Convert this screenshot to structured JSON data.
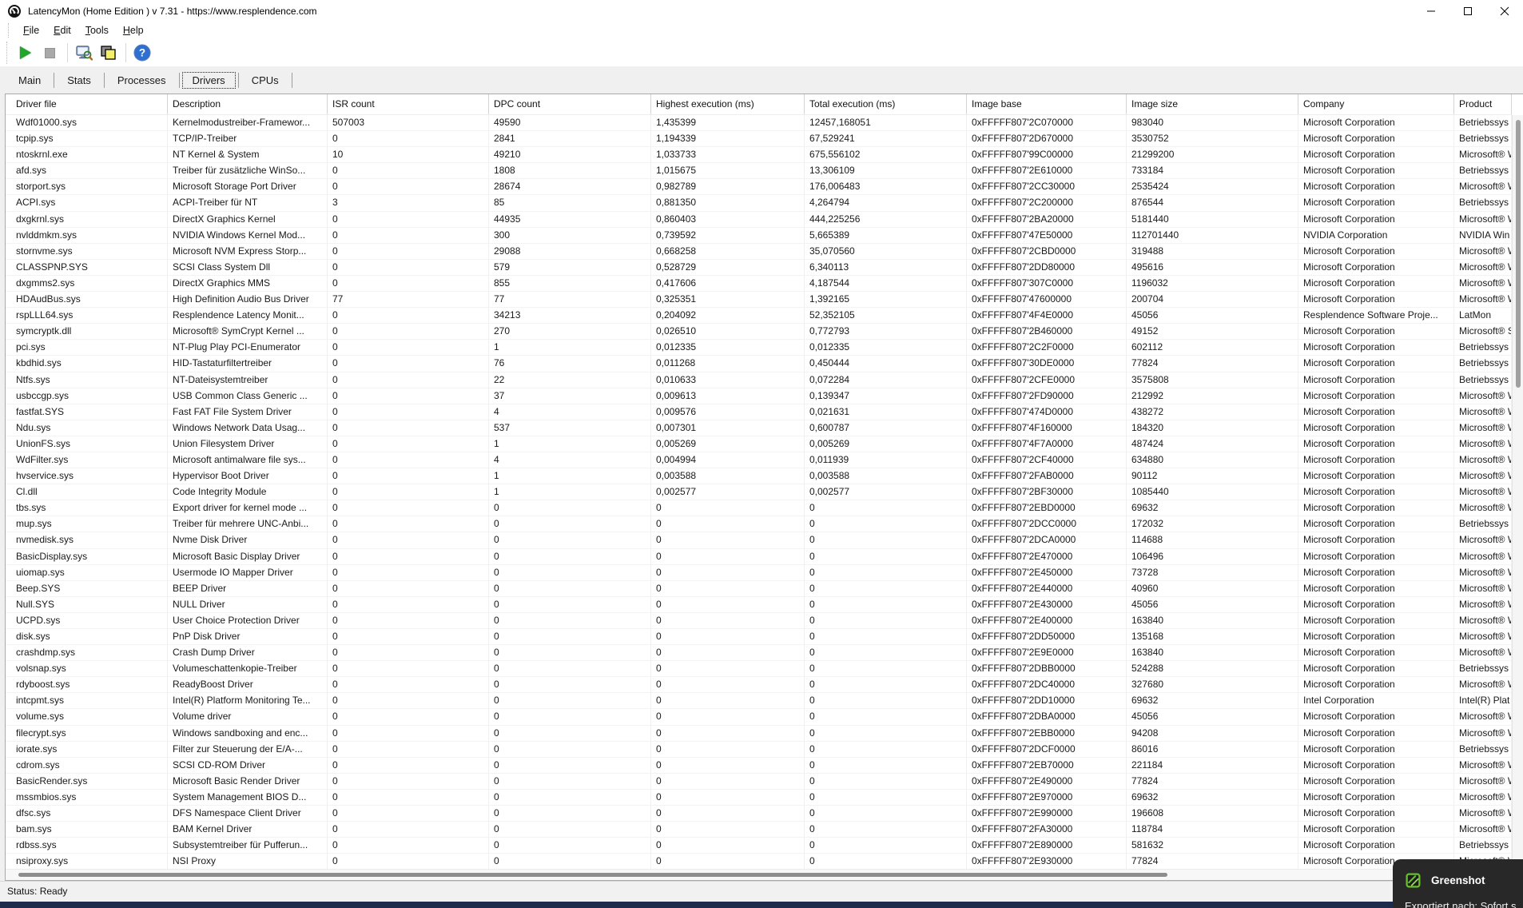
{
  "window": {
    "title": "LatencyMon  (Home Edition )  v 7.31 - https://www.resplendence.com",
    "controls": {
      "minimize": "minimize",
      "maximize": "maximize",
      "close": "close"
    }
  },
  "menu": {
    "items": [
      "File",
      "Edit",
      "Tools",
      "Help"
    ]
  },
  "toolbar": {
    "icons": [
      "start-monitor",
      "stop-monitor",
      "analyze-options",
      "screenshot-copy",
      "help"
    ],
    "colors": {
      "play_green": "#23a52a",
      "stop_gray": "#a9a9a9",
      "help_blue": "#2f6fd0",
      "copy_yellow": "#f4ef6b"
    }
  },
  "tabs": {
    "items": [
      "Main",
      "Stats",
      "Processes",
      "Drivers",
      "CPUs"
    ],
    "active": "Drivers"
  },
  "table": {
    "columns": [
      "Driver file",
      "Description",
      "ISR count",
      "DPC count",
      "Highest execution (ms)",
      "Total execution (ms)",
      "Image base",
      "Image size",
      "Company",
      "Product"
    ],
    "rows": [
      [
        "Wdf01000.sys",
        "Kernelmodustreiber-Framewor...",
        "507003",
        "49590",
        "1,435399",
        "12457,168051",
        "0xFFFFF807'2C070000",
        "983040",
        "Microsoft Corporation",
        "Betriebssys"
      ],
      [
        "tcpip.sys",
        "TCP/IP-Treiber",
        "0",
        "2841",
        "1,194339",
        "67,529241",
        "0xFFFFF807'2D670000",
        "3530752",
        "Microsoft Corporation",
        "Betriebssys"
      ],
      [
        "ntoskrnl.exe",
        "NT Kernel & System",
        "10",
        "49210",
        "1,033733",
        "675,556102",
        "0xFFFFF807'99C00000",
        "21299200",
        "Microsoft Corporation",
        "Microsoft® W"
      ],
      [
        "afd.sys",
        "Treiber für zusätzliche WinSo...",
        "0",
        "1808",
        "1,015675",
        "13,306109",
        "0xFFFFF807'2E610000",
        "733184",
        "Microsoft Corporation",
        "Betriebssys"
      ],
      [
        "storport.sys",
        "Microsoft Storage Port Driver",
        "0",
        "28674",
        "0,982789",
        "176,006483",
        "0xFFFFF807'2CC30000",
        "2535424",
        "Microsoft Corporation",
        "Microsoft® W"
      ],
      [
        "ACPI.sys",
        "ACPI-Treiber für NT",
        "3",
        "85",
        "0,881350",
        "4,264794",
        "0xFFFFF807'2C200000",
        "876544",
        "Microsoft Corporation",
        "Betriebssys"
      ],
      [
        "dxgkrnl.sys",
        "DirectX Graphics Kernel",
        "0",
        "44935",
        "0,860403",
        "444,225256",
        "0xFFFFF807'2BA20000",
        "5181440",
        "Microsoft Corporation",
        "Microsoft® W"
      ],
      [
        "nvlddmkm.sys",
        "NVIDIA Windows Kernel Mod...",
        "0",
        "300",
        "0,739592",
        "5,665389",
        "0xFFFFF807'47E50000",
        "112701440",
        "NVIDIA Corporation",
        "NVIDIA Win"
      ],
      [
        "stornvme.sys",
        "Microsoft NVM Express Storp...",
        "0",
        "29088",
        "0,668258",
        "35,070560",
        "0xFFFFF807'2CBD0000",
        "319488",
        "Microsoft Corporation",
        "Microsoft® W"
      ],
      [
        "CLASSPNP.SYS",
        "SCSI Class System Dll",
        "0",
        "579",
        "0,528729",
        "6,340113",
        "0xFFFFF807'2DD80000",
        "495616",
        "Microsoft Corporation",
        "Microsoft® W"
      ],
      [
        "dxgmms2.sys",
        "DirectX Graphics MMS",
        "0",
        "855",
        "0,417606",
        "4,187544",
        "0xFFFFF807'307C0000",
        "1196032",
        "Microsoft Corporation",
        "Microsoft® W"
      ],
      [
        "HDAudBus.sys",
        "High Definition Audio Bus Driver",
        "77",
        "77",
        "0,325351",
        "1,392165",
        "0xFFFFF807'47600000",
        "200704",
        "Microsoft Corporation",
        "Microsoft® W"
      ],
      [
        "rspLLL64.sys",
        "Resplendence Latency Monit...",
        "0",
        "34213",
        "0,204092",
        "52,352105",
        "0xFFFFF807'4F4E0000",
        "45056",
        "Resplendence Software Proje...",
        "LatMon"
      ],
      [
        "symcryptk.dll",
        "Microsoft® SymCrypt Kernel ...",
        "0",
        "270",
        "0,026510",
        "0,772793",
        "0xFFFFF807'2B460000",
        "49152",
        "Microsoft Corporation",
        "Microsoft® S"
      ],
      [
        "pci.sys",
        "NT-Plug  Play PCI-Enumerator",
        "0",
        "1",
        "0,012335",
        "0,012335",
        "0xFFFFF807'2C2F0000",
        "602112",
        "Microsoft Corporation",
        "Betriebssys"
      ],
      [
        "kbdhid.sys",
        "HID-Tastaturfiltertreiber",
        "0",
        "76",
        "0,011268",
        "0,450444",
        "0xFFFFF807'30DE0000",
        "77824",
        "Microsoft Corporation",
        "Betriebssys"
      ],
      [
        "Ntfs.sys",
        "NT-Dateisystemtreiber",
        "0",
        "22",
        "0,010633",
        "0,072284",
        "0xFFFFF807'2CFE0000",
        "3575808",
        "Microsoft Corporation",
        "Betriebssys"
      ],
      [
        "usbccgp.sys",
        "USB Common Class Generic ...",
        "0",
        "37",
        "0,009613",
        "0,139347",
        "0xFFFFF807'2FD90000",
        "212992",
        "Microsoft Corporation",
        "Microsoft® W"
      ],
      [
        "fastfat.SYS",
        "Fast FAT File System Driver",
        "0",
        "4",
        "0,009576",
        "0,021631",
        "0xFFFFF807'474D0000",
        "438272",
        "Microsoft Corporation",
        "Microsoft® W"
      ],
      [
        "Ndu.sys",
        "Windows Network Data Usag...",
        "0",
        "537",
        "0,007301",
        "0,600787",
        "0xFFFFF807'4F160000",
        "184320",
        "Microsoft Corporation",
        "Microsoft® W"
      ],
      [
        "UnionFS.sys",
        "Union Filesystem Driver",
        "0",
        "1",
        "0,005269",
        "0,005269",
        "0xFFFFF807'4F7A0000",
        "487424",
        "Microsoft Corporation",
        "Microsoft® W"
      ],
      [
        "WdFilter.sys",
        "Microsoft antimalware file sys...",
        "0",
        "4",
        "0,004994",
        "0,011939",
        "0xFFFFF807'2CF40000",
        "634880",
        "Microsoft Corporation",
        "Microsoft® W"
      ],
      [
        "hvservice.sys",
        "Hypervisor Boot Driver",
        "0",
        "1",
        "0,003588",
        "0,003588",
        "0xFFFFF807'2FAB0000",
        "90112",
        "Microsoft Corporation",
        "Microsoft® W"
      ],
      [
        "Cl.dll",
        "Code Integrity Module",
        "0",
        "1",
        "0,002577",
        "0,002577",
        "0xFFFFF807'2BF30000",
        "1085440",
        "Microsoft Corporation",
        "Microsoft® W"
      ],
      [
        "tbs.sys",
        "Export driver for kernel mode ...",
        "0",
        "0",
        "0",
        "0",
        "0xFFFFF807'2EBD0000",
        "69632",
        "Microsoft Corporation",
        "Microsoft® W"
      ],
      [
        "mup.sys",
        "Treiber für mehrere UNC-Anbi...",
        "0",
        "0",
        "0",
        "0",
        "0xFFFFF807'2DCC0000",
        "172032",
        "Microsoft Corporation",
        "Betriebssys"
      ],
      [
        "nvmedisk.sys",
        "Nvme Disk Driver",
        "0",
        "0",
        "0",
        "0",
        "0xFFFFF807'2DCA0000",
        "114688",
        "Microsoft Corporation",
        "Microsoft® W"
      ],
      [
        "BasicDisplay.sys",
        "Microsoft Basic Display Driver",
        "0",
        "0",
        "0",
        "0",
        "0xFFFFF807'2E470000",
        "106496",
        "Microsoft Corporation",
        "Microsoft® W"
      ],
      [
        "uiomap.sys",
        "Usermode IO Mapper Driver",
        "0",
        "0",
        "0",
        "0",
        "0xFFFFF807'2E450000",
        "73728",
        "Microsoft Corporation",
        "Microsoft® W"
      ],
      [
        "Beep.SYS",
        "BEEP Driver",
        "0",
        "0",
        "0",
        "0",
        "0xFFFFF807'2E440000",
        "40960",
        "Microsoft Corporation",
        "Microsoft® W"
      ],
      [
        "Null.SYS",
        "NULL Driver",
        "0",
        "0",
        "0",
        "0",
        "0xFFFFF807'2E430000",
        "45056",
        "Microsoft Corporation",
        "Microsoft® W"
      ],
      [
        "UCPD.sys",
        "User Choice Protection Driver",
        "0",
        "0",
        "0",
        "0",
        "0xFFFFF807'2E400000",
        "163840",
        "Microsoft Corporation",
        "Microsoft® W"
      ],
      [
        "disk.sys",
        "PnP Disk Driver",
        "0",
        "0",
        "0",
        "0",
        "0xFFFFF807'2DD50000",
        "135168",
        "Microsoft Corporation",
        "Microsoft® W"
      ],
      [
        "crashdmp.sys",
        "Crash Dump Driver",
        "0",
        "0",
        "0",
        "0",
        "0xFFFFF807'2E9E0000",
        "163840",
        "Microsoft Corporation",
        "Microsoft® W"
      ],
      [
        "volsnap.sys",
        "Volumeschattenkopie-Treiber",
        "0",
        "0",
        "0",
        "0",
        "0xFFFFF807'2DBB0000",
        "524288",
        "Microsoft Corporation",
        "Betriebssys"
      ],
      [
        "rdyboost.sys",
        "ReadyBoost Driver",
        "0",
        "0",
        "0",
        "0",
        "0xFFFFF807'2DC40000",
        "327680",
        "Microsoft Corporation",
        "Microsoft® W"
      ],
      [
        "intcpmt.sys",
        "Intel(R) Platform Monitoring Te...",
        "0",
        "0",
        "0",
        "0",
        "0xFFFFF807'2DD10000",
        "69632",
        "Intel Corporation",
        "Intel(R) Plat"
      ],
      [
        "volume.sys",
        "Volume driver",
        "0",
        "0",
        "0",
        "0",
        "0xFFFFF807'2DBA0000",
        "45056",
        "Microsoft Corporation",
        "Microsoft® W"
      ],
      [
        "filecrypt.sys",
        "Windows sandboxing and enc...",
        "0",
        "0",
        "0",
        "0",
        "0xFFFFF807'2EBB0000",
        "94208",
        "Microsoft Corporation",
        "Microsoft® W"
      ],
      [
        "iorate.sys",
        "Filter zur Steuerung der E/A-...",
        "0",
        "0",
        "0",
        "0",
        "0xFFFFF807'2DCF0000",
        "86016",
        "Microsoft Corporation",
        "Betriebssys"
      ],
      [
        "cdrom.sys",
        "SCSI CD-ROM Driver",
        "0",
        "0",
        "0",
        "0",
        "0xFFFFF807'2EB70000",
        "221184",
        "Microsoft Corporation",
        "Microsoft® W"
      ],
      [
        "BasicRender.sys",
        "Microsoft Basic Render Driver",
        "0",
        "0",
        "0",
        "0",
        "0xFFFFF807'2E490000",
        "77824",
        "Microsoft Corporation",
        "Microsoft® W"
      ],
      [
        "mssmbios.sys",
        "System Management BIOS D...",
        "0",
        "0",
        "0",
        "0",
        "0xFFFFF807'2E970000",
        "69632",
        "Microsoft Corporation",
        "Microsoft® W"
      ],
      [
        "dfsc.sys",
        "DFS Namespace Client Driver",
        "0",
        "0",
        "0",
        "0",
        "0xFFFFF807'2E990000",
        "196608",
        "Microsoft Corporation",
        "Microsoft® W"
      ],
      [
        "bam.sys",
        "BAM Kernel Driver",
        "0",
        "0",
        "0",
        "0",
        "0xFFFFF807'2FA30000",
        "118784",
        "Microsoft Corporation",
        "Microsoft® W"
      ],
      [
        "rdbss.sys",
        "Subsystemtreiber für Pufferun...",
        "0",
        "0",
        "0",
        "0",
        "0xFFFFF807'2E890000",
        "581632",
        "Microsoft Corporation",
        "Betriebssys"
      ],
      [
        "nsiproxy.sys",
        "NSI Proxy",
        "0",
        "0",
        "0",
        "0",
        "0xFFFFF807'2E930000",
        "77824",
        "Microsoft Corporation",
        "Microsoft® W"
      ]
    ]
  },
  "statusbar": {
    "text": "Status: Ready"
  },
  "toast": {
    "app": "Greenshot",
    "message": "Exportiert nach: Sofort s",
    "bg": "#282828",
    "green": "#69bf2f"
  }
}
